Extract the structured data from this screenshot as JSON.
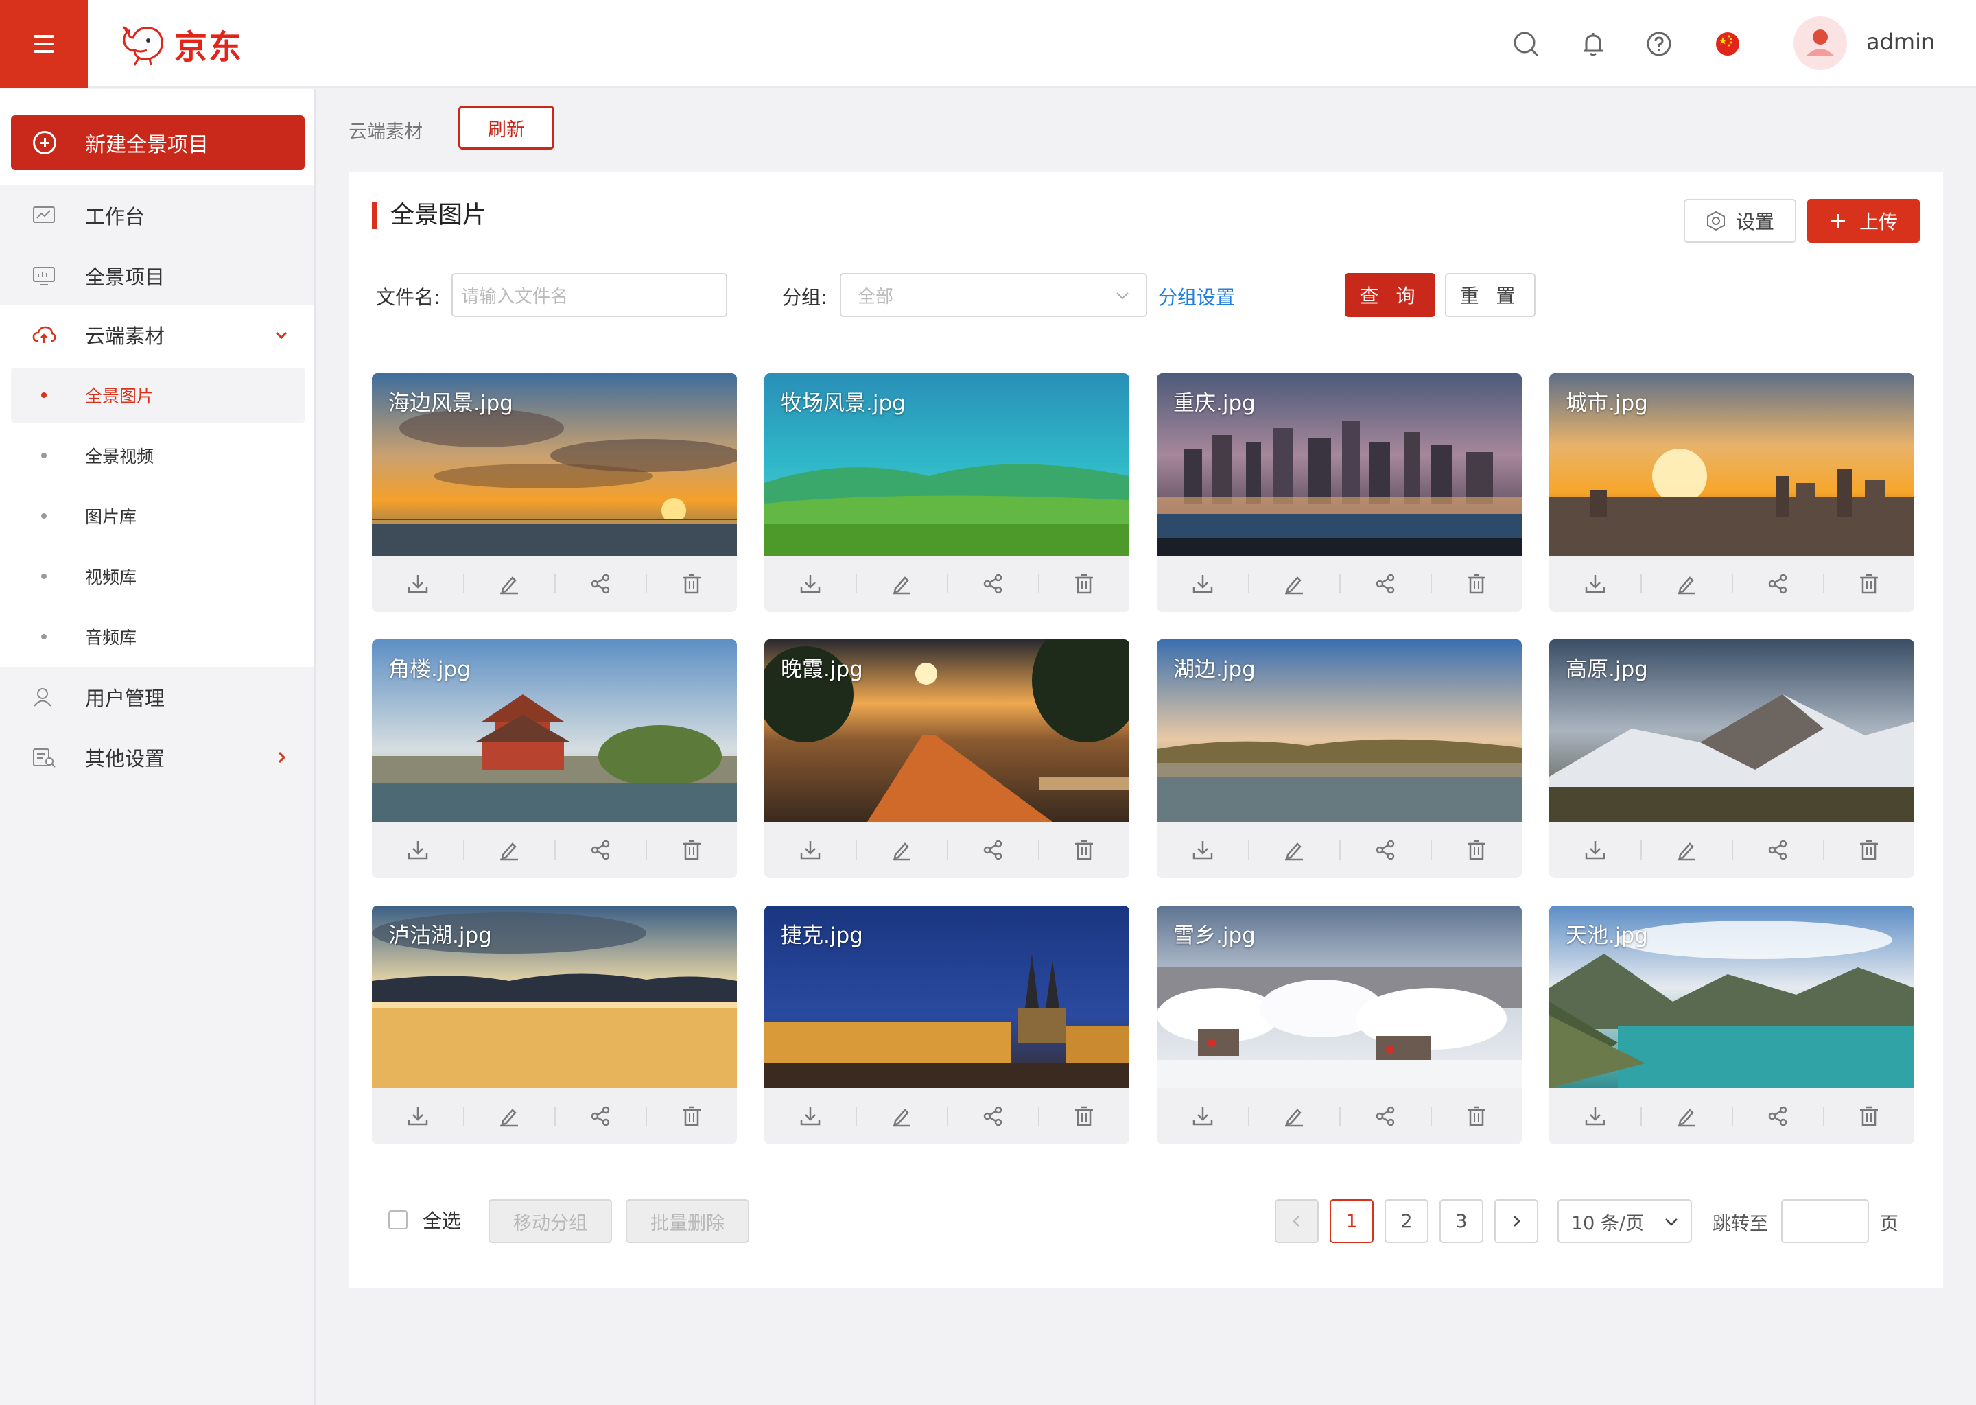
{
  "header": {
    "brand": "京东",
    "username": "admin",
    "icons": [
      "menu-icon",
      "search-icon",
      "bell-icon",
      "help-icon",
      "china-flag-icon",
      "avatar"
    ]
  },
  "sidebar": {
    "new_button": "新建全景项目",
    "items": [
      {
        "label": "工作台",
        "icon": "dashboard-icon"
      },
      {
        "label": "全景项目",
        "icon": "monitor-icon"
      },
      {
        "label": "云端素材",
        "icon": "cloud-upload-icon",
        "expanded": true
      },
      {
        "label": "用户管理",
        "icon": "user-icon"
      },
      {
        "label": "其他设置",
        "icon": "settings-list-icon"
      }
    ],
    "subitems": [
      {
        "label": "全景图片",
        "active": true
      },
      {
        "label": "全景视频"
      },
      {
        "label": "图片库"
      },
      {
        "label": "视频库"
      },
      {
        "label": "音频库"
      }
    ]
  },
  "toolbar": {
    "breadcrumb": "云端素材",
    "refresh": "刷新"
  },
  "panel": {
    "title": "全景图片",
    "setting_btn": "设置",
    "upload_btn": "上传",
    "filename_label": "文件名:",
    "filename_placeholder": "请输入文件名",
    "group_label": "分组:",
    "group_value": "全部",
    "group_link": "分组设置",
    "query_btn": "查 询",
    "reset_btn": "重 置"
  },
  "images": [
    {
      "name": "海边风景.jpg",
      "scene": "sunset-sea"
    },
    {
      "name": "牧场风景.jpg",
      "scene": "pasture"
    },
    {
      "name": "重庆.jpg",
      "scene": "night-city"
    },
    {
      "name": "城市.jpg",
      "scene": "city-sunrise"
    },
    {
      "name": "角楼.jpg",
      "scene": "palace"
    },
    {
      "name": "晚霞.jpg",
      "scene": "park-sunset"
    },
    {
      "name": "湖边.jpg",
      "scene": "lake-dusk"
    },
    {
      "name": "高原.jpg",
      "scene": "snow-mountain"
    },
    {
      "name": "泸沽湖.jpg",
      "scene": "lake-sunset"
    },
    {
      "name": "捷克.jpg",
      "scene": "prague-night"
    },
    {
      "name": "雪乡.jpg",
      "scene": "snow-village"
    },
    {
      "name": "天池.jpg",
      "scene": "mountain-lake"
    }
  ],
  "footer": {
    "select_all": "全选",
    "move_group": "移动分组",
    "batch_delete": "批量删除",
    "pages": [
      "1",
      "2",
      "3"
    ],
    "current_page": "1",
    "page_size": "10 条/页",
    "jump_label": "跳转至",
    "page_unit": "页"
  },
  "colors": {
    "accent": "#d8321d",
    "link": "#1f7fe0"
  }
}
